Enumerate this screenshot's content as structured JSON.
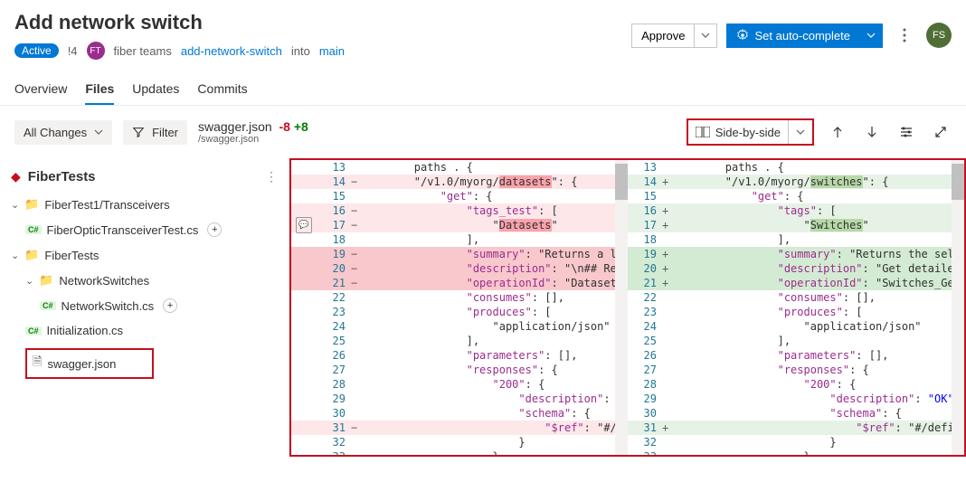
{
  "header": {
    "title": "Add network switch",
    "status": "Active",
    "pr_number": "!4",
    "team_initials": "FT",
    "team_name": "fiber teams",
    "branch_source": "add-network-switch",
    "into_label": "into",
    "branch_target": "main",
    "approve_label": "Approve",
    "autocomplete_label": "Set auto-complete",
    "user_initials": "FS"
  },
  "tabs": [
    "Overview",
    "Files",
    "Updates",
    "Commits"
  ],
  "toolbar": {
    "all_changes": "All Changes",
    "filter": "Filter",
    "file_name": "swagger.json",
    "file_path": "/swagger.json",
    "removed": "-8",
    "added": "+8",
    "view_mode": "Side-by-side"
  },
  "sidebar": {
    "project": "FiberTests",
    "tree": {
      "f1": "FiberTest1/Transceivers",
      "file1": "FiberOpticTransceiverTest.cs",
      "f2": "FiberTests",
      "f3": "NetworkSwitches",
      "file2": "NetworkSwitch.cs",
      "file3": "Initialization.cs",
      "file4": "swagger.json"
    }
  },
  "diff": {
    "left": [
      {
        "n": "13",
        "sign": "",
        "cls": "",
        "code": "        paths . {"
      },
      {
        "n": "14",
        "sign": "−",
        "cls": "del-bg",
        "code": "        \"/v1.0/myorg/",
        "hl": "datasets",
        "code2": "\": {"
      },
      {
        "n": "15",
        "sign": "",
        "cls": "",
        "code": "            \"get\": {"
      },
      {
        "n": "16",
        "sign": "−",
        "cls": "del-bg",
        "code": "                \"tags_test\": ["
      },
      {
        "n": "17",
        "sign": "−",
        "cls": "del-bg",
        "code": "                    \"",
        "hl": "Datasets",
        "code2": "\""
      },
      {
        "n": "18",
        "sign": "",
        "cls": "",
        "code": "                ],"
      },
      {
        "n": "19",
        "sign": "−",
        "cls": "del-full",
        "code": "                \"summary\": \"Returns a list of"
      },
      {
        "n": "20",
        "sign": "−",
        "cls": "del-full",
        "code": "                \"description\": \"\\n## Required"
      },
      {
        "n": "21",
        "sign": "−",
        "cls": "del-full",
        "code": "                \"operationId\": \"Datasets_GetD"
      },
      {
        "n": "22",
        "sign": "",
        "cls": "",
        "code": "                \"consumes\": [],"
      },
      {
        "n": "23",
        "sign": "",
        "cls": "",
        "code": "                \"produces\": ["
      },
      {
        "n": "24",
        "sign": "",
        "cls": "",
        "code": "                    \"application/json\""
      },
      {
        "n": "25",
        "sign": "",
        "cls": "",
        "code": "                ],"
      },
      {
        "n": "26",
        "sign": "",
        "cls": "",
        "code": "                \"parameters\": [],"
      },
      {
        "n": "27",
        "sign": "",
        "cls": "",
        "code": "                \"responses\": {"
      },
      {
        "n": "28",
        "sign": "",
        "cls": "",
        "code": "                    \"200\": {"
      },
      {
        "n": "29",
        "sign": "",
        "cls": "",
        "code": "                        \"description\": \"OK\","
      },
      {
        "n": "30",
        "sign": "",
        "cls": "",
        "code": "                        \"schema\": {"
      },
      {
        "n": "31",
        "sign": "−",
        "cls": "del-bg",
        "code": "                            \"$ref\": \"#/definit"
      },
      {
        "n": "32",
        "sign": "",
        "cls": "",
        "code": "                        }"
      },
      {
        "n": "33",
        "sign": "",
        "cls": "",
        "code": "                    }"
      }
    ],
    "right": [
      {
        "n": "13",
        "sign": "",
        "cls": "",
        "code": "        paths . {"
      },
      {
        "n": "14",
        "sign": "+",
        "cls": "add-bg",
        "code": "        \"/v1.0/myorg/",
        "hl": "switches",
        "code2": "\": {"
      },
      {
        "n": "15",
        "sign": "",
        "cls": "",
        "code": "            \"get\": {"
      },
      {
        "n": "16",
        "sign": "+",
        "cls": "add-bg",
        "code": "                \"tags\": ["
      },
      {
        "n": "17",
        "sign": "+",
        "cls": "add-bg",
        "code": "                    \"",
        "hl": "Switches",
        "code2": "\""
      },
      {
        "n": "18",
        "sign": "",
        "cls": "",
        "code": "                ],"
      },
      {
        "n": "19",
        "sign": "+",
        "cls": "add-full",
        "code": "                \"summary\": \"Returns the select"
      },
      {
        "n": "20",
        "sign": "+",
        "cls": "add-full",
        "code": "                \"description\": \"Get detailed s"
      },
      {
        "n": "21",
        "sign": "+",
        "cls": "add-full",
        "code": "                \"operationId\": \"Switches_GetSw"
      },
      {
        "n": "22",
        "sign": "",
        "cls": "",
        "code": "                \"consumes\": [],"
      },
      {
        "n": "23",
        "sign": "",
        "cls": "",
        "code": "                \"produces\": ["
      },
      {
        "n": "24",
        "sign": "",
        "cls": "",
        "code": "                    \"application/json\""
      },
      {
        "n": "25",
        "sign": "",
        "cls": "",
        "code": "                ],"
      },
      {
        "n": "26",
        "sign": "",
        "cls": "",
        "code": "                \"parameters\": [],"
      },
      {
        "n": "27",
        "sign": "",
        "cls": "",
        "code": "                \"responses\": {"
      },
      {
        "n": "28",
        "sign": "",
        "cls": "",
        "code": "                    \"200\": {"
      },
      {
        "n": "29",
        "sign": "",
        "cls": "",
        "code": "                        \"description\": \"OK\","
      },
      {
        "n": "30",
        "sign": "",
        "cls": "",
        "code": "                        \"schema\": {"
      },
      {
        "n": "31",
        "sign": "+",
        "cls": "add-bg",
        "code": "                            \"$ref\": \"#/definit"
      },
      {
        "n": "32",
        "sign": "",
        "cls": "",
        "code": "                        }"
      },
      {
        "n": "33",
        "sign": "",
        "cls": "",
        "code": "                    }"
      }
    ]
  }
}
